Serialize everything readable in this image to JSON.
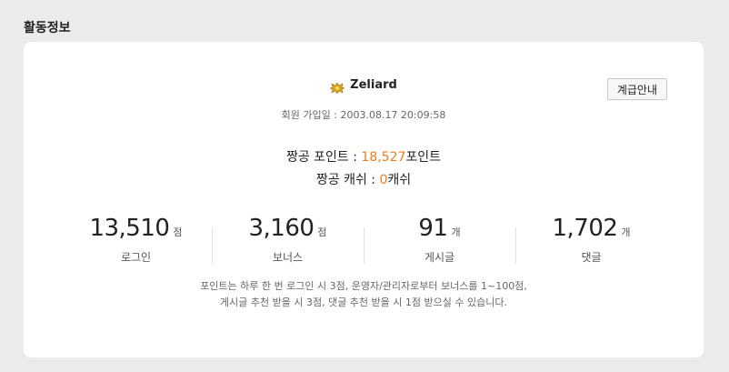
{
  "section_title": "활동정보",
  "grade_button_label": "계급안내",
  "user": {
    "badge_icon": "gold-rank-badge-icon",
    "name": "Zeliard",
    "join_label": "회원 가입일 : ",
    "join_date": "2003.08.17 20:09:58"
  },
  "points": {
    "label": "짱공 포인트 : ",
    "value": "18,527",
    "unit": "포인트"
  },
  "cash": {
    "label": "짱공 캐쉬 : ",
    "value": "0",
    "unit": "캐쉬"
  },
  "stats": [
    {
      "value": "13,510",
      "unit": "점",
      "label": "로그인"
    },
    {
      "value": "3,160",
      "unit": "점",
      "label": "보너스"
    },
    {
      "value": "91",
      "unit": "개",
      "label": "게시글"
    },
    {
      "value": "1,702",
      "unit": "개",
      "label": "댓글"
    }
  ],
  "notice": {
    "line1": "포인트는 하루 한 번 로그인 시 3점, 운영자/관리자로부터 보너스를 1~100점,",
    "line2": "게시글 추천 받을 시 3점, 댓글 추천 받을 시 1점 받으실 수 있습니다."
  },
  "colors": {
    "accent": "#f07a1e",
    "background": "#ebebeb",
    "card": "#ffffff"
  }
}
